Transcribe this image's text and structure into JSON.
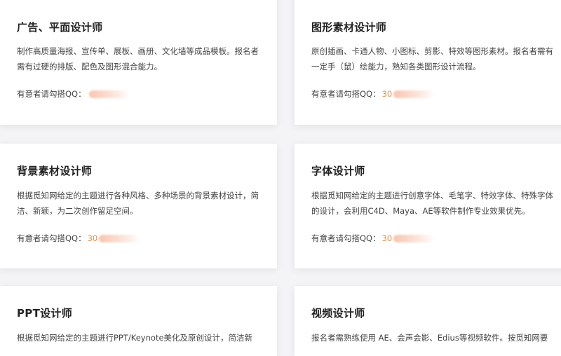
{
  "cards": [
    {
      "title": "广告、平面设计师",
      "desc": "制作高质量海报、宣传单、展板、画册、文化墙等成品模板。报名者需有过硬的排版、配色及图形混合能力。",
      "qq_label": "有意者请勾搭QQ：",
      "qq_number": ""
    },
    {
      "title": "图形素材设计师",
      "desc": "原创插画、卡通人物、小图标、剪影、特效等图形素材。报名者需有一定手（鼠）绘能力，熟知各类图形设计流程。",
      "qq_label": "有意者请勾搭QQ：",
      "qq_number": "30"
    },
    {
      "title": "背景素材设计师",
      "desc": "根据觅知网给定的主题进行各种风格、多种场景的背景素材设计，简洁、新颖，为二次创作留足空间。",
      "qq_label": "有意者请勾搭QQ：",
      "qq_number": "30"
    },
    {
      "title": "字体设计师",
      "desc": "根据觅知网给定的主题进行创意字体、毛笔字、特效字体、特殊字体的设计，会利用C4D、Maya、AE等软件制作专业效果优先。",
      "qq_label": "有意者请勾搭QQ：",
      "qq_number": "30"
    },
    {
      "title": "PPT设计师",
      "desc": "根据觅知网给定的主题进行PPT/Keynote美化及原创设计，简洁新",
      "qq_label": "",
      "qq_number": ""
    },
    {
      "title": "视频设计师",
      "desc": "报名者需熟练使用 AE、会声会影、Edius等视频软件。按觅知网要",
      "qq_label": "",
      "qq_number": ""
    }
  ]
}
